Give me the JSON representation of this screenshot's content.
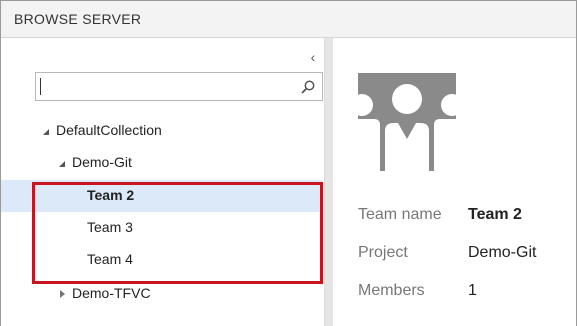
{
  "window": {
    "title": "BROWSE SERVER"
  },
  "left_pane": {
    "collapse_glyph": "‹",
    "search": {
      "placeholder": "",
      "value": ""
    },
    "tree": [
      {
        "label": "DefaultCollection",
        "expanded": true,
        "level": 0
      },
      {
        "label": "Demo-Git",
        "expanded": true,
        "level": 1
      },
      {
        "label": "Team 2",
        "selected": true,
        "level": 2
      },
      {
        "label": "Team 3",
        "level": 2
      },
      {
        "label": "Team 4",
        "level": 2
      },
      {
        "label": "Demo-TFVC",
        "expanded": false,
        "level": 1
      }
    ],
    "highlight_color": "#c8141e",
    "selection_color": "#dce9f8"
  },
  "details": {
    "icon": "team-group-icon",
    "properties": [
      {
        "key": "Team name",
        "value": "Team 2"
      },
      {
        "key": "Project",
        "value": "Demo-Git"
      },
      {
        "key": "Members",
        "value": "1"
      }
    ]
  }
}
